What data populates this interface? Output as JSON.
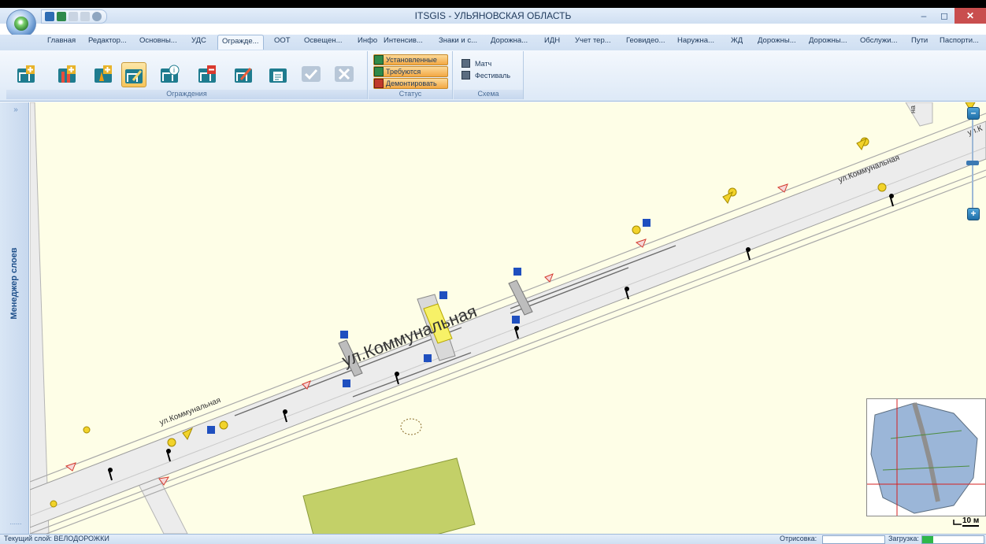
{
  "window": {
    "title": "ITSGIS - УЛЬЯНОВСКАЯ ОБЛАСТЬ",
    "minimize": "–",
    "maximize": "◻",
    "close": "✕"
  },
  "tabs": [
    {
      "label": "Главная"
    },
    {
      "label": "Редактор..."
    },
    {
      "label": "Основны..."
    },
    {
      "label": "УДС"
    },
    {
      "label": "Огражде...",
      "active": true
    },
    {
      "label": "ООТ"
    },
    {
      "label": "Освещен..."
    },
    {
      "label": "Инфо"
    },
    {
      "label": "Интенсив..."
    },
    {
      "label": "Знаки и с..."
    },
    {
      "label": "Дорожна..."
    },
    {
      "label": "ИДН"
    },
    {
      "label": "Учет тер..."
    },
    {
      "label": "Геовидео..."
    },
    {
      "label": "Наружна..."
    },
    {
      "label": "ЖД"
    },
    {
      "label": "Дорожны..."
    },
    {
      "label": "Дорожны..."
    },
    {
      "label": "Обслужи..."
    },
    {
      "label": "Пути"
    },
    {
      "label": "Паспорти..."
    }
  ],
  "ribbon": {
    "fences_group_label": "Ограждения",
    "status_group_label": "Статус",
    "schema_group_label": "Схема",
    "status_buttons": [
      "Установленные",
      "Требуются",
      "Демонтировать"
    ],
    "schema_items": [
      "Матч",
      "Фестиваль"
    ]
  },
  "layer_manager": {
    "title": "Менеджер слоев",
    "collapse": "»",
    "grip": "......"
  },
  "map": {
    "street_big": "ул.Коммунальная",
    "street_small": "ул.Коммунальная",
    "street_edge": "ул.К",
    "street_top": "на",
    "scale": "10 м"
  },
  "status": {
    "current_layer": "Текущий слой: ВЕЛОДОРОЖКИ",
    "render_label": "Отрисовка:",
    "load_label": "Загрузка:",
    "load_fraction": 0.18
  },
  "colors": {
    "map_background": "#fefee7",
    "road": "#ececec",
    "ribbon_selected": "#f8c55a",
    "parcel": "#c3d068",
    "accent": "#1e4f8a"
  }
}
